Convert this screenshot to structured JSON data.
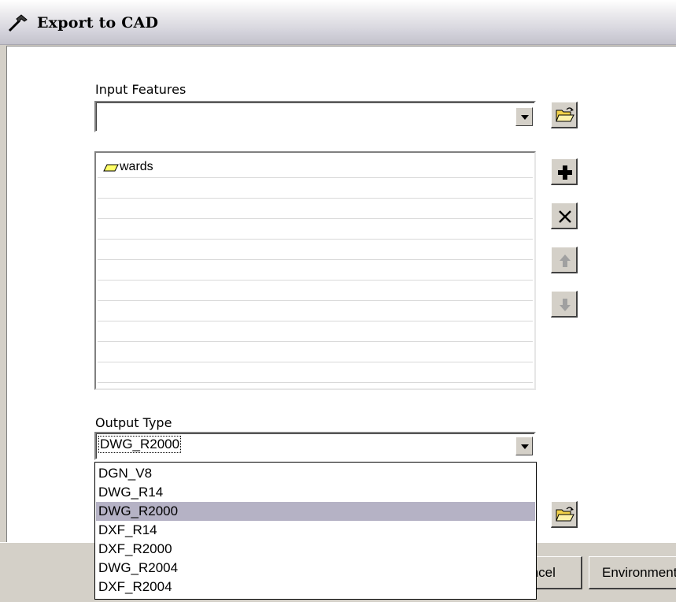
{
  "window": {
    "title": "Export to CAD",
    "icon": "hammer-icon"
  },
  "input_features": {
    "label": "Input Features",
    "value": "",
    "browse_icon": "open-folder-icon",
    "items": [
      "wards"
    ],
    "item_icon": "polygon-layer-icon",
    "buttons": {
      "add_icon": "plus-icon",
      "remove_icon": "close-x-icon",
      "up_icon": "arrow-up-icon",
      "down_icon": "arrow-down-icon"
    }
  },
  "output_type": {
    "label": "Output Type",
    "value": "DWG_R2000",
    "options": [
      "DGN_V8",
      "DWG_R14",
      "DWG_R2000",
      "DXF_R14",
      "DXF_R2000",
      "DWG_R2004",
      "DXF_R2004"
    ],
    "highlighted": "DWG_R2000"
  },
  "output_file": {
    "browse_icon": "open-folder-icon"
  },
  "footer": {
    "cancel_label": "Cancel",
    "environments_label": "Environments..."
  },
  "colors": {
    "face": "#d4d0c8",
    "highlight_row": "#b5b2c5",
    "titlebar": "#e8e7ec"
  }
}
